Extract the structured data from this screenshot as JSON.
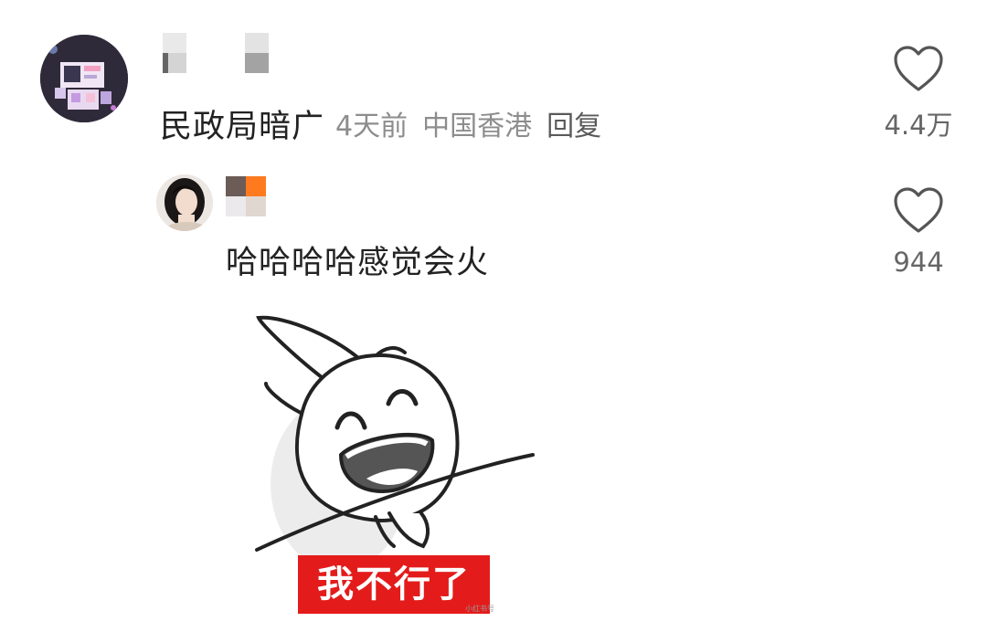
{
  "comment": {
    "text": "民政局暗广",
    "time": "4天前",
    "location": "中国香港",
    "reply_label": "回复",
    "likes": "4.4万",
    "like_icon": "heart-outline-icon"
  },
  "reply": {
    "text": "哈哈哈哈感觉会火",
    "likes": "944",
    "like_icon": "heart-outline-icon",
    "sticker": {
      "caption": "我不行了",
      "watermark": "小红书号"
    }
  },
  "colors": {
    "primary_text": "#222222",
    "meta_text": "#8d8d8d",
    "icon_stroke": "#555555",
    "sticker_caption_bg": "#e41b1b"
  }
}
